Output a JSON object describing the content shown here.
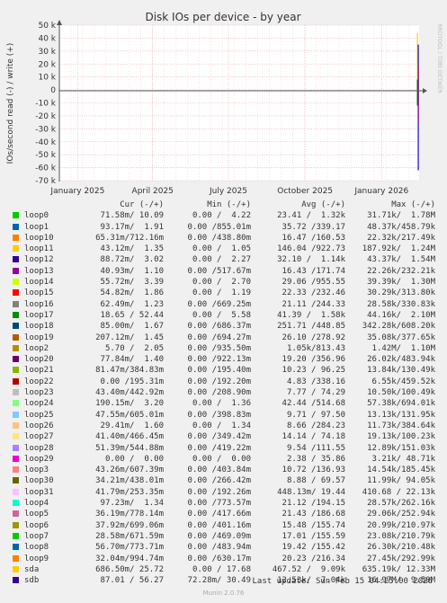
{
  "chart_data": {
    "type": "line",
    "title": "Disk IOs per device - by year",
    "ylabel": "IOs/second read (-) / write (+)",
    "side_label": "RRDTOOL / TOBI OETIKER",
    "ylim": [
      -70000,
      50000
    ],
    "y_ticks": [
      50000,
      40000,
      30000,
      20000,
      10000,
      0,
      -10000,
      -20000,
      -30000,
      -40000,
      -50000,
      -60000,
      -70000
    ],
    "y_tick_labels": [
      "50 k",
      "40 k",
      "30 k",
      "20 k",
      "10 k",
      "0",
      "-10 k",
      "-20 k",
      "-30 k",
      "-40 k",
      "-50 k",
      "-60 k",
      "-70 k"
    ],
    "x_range": [
      "2024-12-10",
      "2026-02-15"
    ],
    "x_ticks": [
      "2025-01-01",
      "2025-04-01",
      "2025-07-01",
      "2025-10-01",
      "2026-01-01"
    ],
    "x_tick_labels": [
      "January 2025",
      "April 2025",
      "July 2025",
      "October 2025",
      "January 2026"
    ],
    "grid": true,
    "series_spikes": [
      {
        "color": "#ffcc00",
        "x": "2026-02-13",
        "y_top": 44000,
        "y_bottom": -9500
      },
      {
        "color": "#1a00cc",
        "x": "2026-02-14",
        "y_top": 35000,
        "y_bottom": -62000
      },
      {
        "color": "#880088",
        "x": "2026-02-14",
        "y_top": 18000,
        "y_bottom": -25000
      },
      {
        "color": "#006600",
        "x": "2026-02-13",
        "y_top": 8000,
        "y_bottom": -12000
      }
    ],
    "headers": {
      "cur": "Cur (-/+)",
      "min": "Min (-/+)",
      "avg": "Avg (-/+)",
      "max": "Max (-/+)"
    },
    "series": [
      {
        "name": "loop0",
        "color": "#00cc00",
        "cur": "71.58m/ 10.09",
        "min": "0.00 /  4.22",
        "avg": "23.41 /  1.32k",
        "max": "31.71k/  1.78M"
      },
      {
        "name": "loop1",
        "color": "#0066b3",
        "cur": "93.17m/  1.91",
        "min": "0.00 /855.01m",
        "avg": "35.72 /339.17",
        "max": "48.37k/458.79k"
      },
      {
        "name": "loop10",
        "color": "#ff8000",
        "cur": "65.31m/712.16m",
        "min": "0.00 /438.80m",
        "avg": "16.47 /160.53",
        "max": "22.32k/217.49k"
      },
      {
        "name": "loop11",
        "color": "#ffcc00",
        "cur": "43.12m/  1.35",
        "min": "0.00 /  1.05",
        "avg": "146.04 /922.73",
        "max": "187.92k/  1.24M"
      },
      {
        "name": "loop12",
        "color": "#330099",
        "cur": "88.72m/  3.02",
        "min": "0.00 /  2.27",
        "avg": "32.10 /  1.14k",
        "max": "43.37k/  1.54M"
      },
      {
        "name": "loop13",
        "color": "#990099",
        "cur": "40.93m/  1.10",
        "min": "0.00 /517.67m",
        "avg": "16.43 /171.74",
        "max": "22.26k/232.21k"
      },
      {
        "name": "loop14",
        "color": "#ccff00",
        "cur": "55.72m/  3.39",
        "min": "0.00 /  2.70",
        "avg": "29.06 /955.55",
        "max": "39.39k/  1.30M"
      },
      {
        "name": "loop15",
        "color": "#ff0000",
        "cur": "54.82m/  1.86",
        "min": "0.00 /  1.19",
        "avg": "22.33 /232.46",
        "max": "30.29k/313.80k"
      },
      {
        "name": "loop16",
        "color": "#808080",
        "cur": "62.49m/  1.23",
        "min": "0.00 /669.25m",
        "avg": "21.11 /244.33",
        "max": "28.58k/330.83k"
      },
      {
        "name": "loop17",
        "color": "#008f00",
        "cur": "18.65 / 52.44",
        "min": "0.00 /  5.58",
        "avg": "41.39 /  1.58k",
        "max": "44.16k/  2.10M"
      },
      {
        "name": "loop18",
        "color": "#00487d",
        "cur": "85.00m/  1.67",
        "min": "0.00 /686.37m",
        "avg": "251.71 /448.85",
        "max": "342.28k/608.20k"
      },
      {
        "name": "loop19",
        "color": "#b35a00",
        "cur": "207.12m/  1.45",
        "min": "0.00 /694.27m",
        "avg": "26.10 /278.92",
        "max": "35.08k/377.65k"
      },
      {
        "name": "loop2",
        "color": "#b38f00",
        "cur": "5.70 /  2.05",
        "min": "0.00 /935.50m",
        "avg": "1.05k/813.43",
        "max": "1.42M/  1.10M"
      },
      {
        "name": "loop20",
        "color": "#6b006b",
        "cur": "77.84m/  1.40",
        "min": "0.00 /922.13m",
        "avg": "19.20 /356.96",
        "max": "26.02k/483.94k"
      },
      {
        "name": "loop21",
        "color": "#8fb300",
        "cur": "81.47m/384.83m",
        "min": "0.00 /195.40m",
        "avg": "10.23 / 96.25",
        "max": "13.84k/130.49k"
      },
      {
        "name": "loop22",
        "color": "#b30000",
        "cur": "0.00 /195.31m",
        "min": "0.00 /192.20m",
        "avg": "4.83 /338.16",
        "max": "6.55k/459.52k"
      },
      {
        "name": "loop23",
        "color": "#bebebe",
        "cur": "43.40m/442.92m",
        "min": "0.00 /208.90m",
        "avg": "7.77 / 74.29",
        "max": "10.50k/100.49k"
      },
      {
        "name": "loop24",
        "color": "#80ff80",
        "cur": "190.15m/  3.20",
        "min": "0.00 /  1.36",
        "avg": "42.44 /514.68",
        "max": "57.38k/694.01k"
      },
      {
        "name": "loop25",
        "color": "#80c9ff",
        "cur": "47.55m/605.01m",
        "min": "0.00 /398.83m",
        "avg": "9.71 / 97.50",
        "max": "13.13k/131.95k"
      },
      {
        "name": "loop26",
        "color": "#ffc080",
        "cur": "29.41m/  1.60",
        "min": "0.00 /  1.34",
        "avg": "8.66 /284.23",
        "max": "11.73k/384.64k"
      },
      {
        "name": "loop27",
        "color": "#ffe680",
        "cur": "41.40m/466.45m",
        "min": "0.00 /349.42m",
        "avg": "14.14 / 74.18",
        "max": "19.13k/100.23k"
      },
      {
        "name": "loop28",
        "color": "#aa80ff",
        "cur": "51.39m/544.88m",
        "min": "0.00 /419.22m",
        "avg": "9.54 /111.55",
        "max": "12.89k/151.03k"
      },
      {
        "name": "loop29",
        "color": "#ee00cc",
        "cur": "0.00 /  0.00",
        "min": "0.00 /  0.00",
        "avg": "2.38 / 35.86",
        "max": "3.21k/ 48.71k"
      },
      {
        "name": "loop3",
        "color": "#ff8080",
        "cur": "43.26m/607.39m",
        "min": "0.00 /403.84m",
        "avg": "10.72 /136.93",
        "max": "14.54k/185.45k"
      },
      {
        "name": "loop30",
        "color": "#666600",
        "cur": "34.21m/438.01m",
        "min": "0.00 /266.42m",
        "avg": "8.88 / 69.57",
        "max": "11.99k/ 94.05k"
      },
      {
        "name": "loop31",
        "color": "#ffbfff",
        "cur": "41.79m/253.35m",
        "min": "0.00 /192.26m",
        "avg": "448.13m/ 19.44",
        "max": "410.68 / 22.13k"
      },
      {
        "name": "loop4",
        "color": "#00ffcc",
        "cur": "97.23m/  1.34",
        "min": "0.00 /773.57m",
        "avg": "21.12 /194.15",
        "max": "28.57k/262.16k"
      },
      {
        "name": "loop5",
        "color": "#cc6699",
        "cur": "36.19m/778.14m",
        "min": "0.00 /417.66m",
        "avg": "21.43 /186.68",
        "max": "29.06k/252.94k"
      },
      {
        "name": "loop6",
        "color": "#999900",
        "cur": "37.92m/699.06m",
        "min": "0.00 /401.16m",
        "avg": "15.48 /155.74",
        "max": "20.99k/210.97k"
      },
      {
        "name": "loop7",
        "color": "#00cc00",
        "cur": "28.58m/671.59m",
        "min": "0.00 /469.09m",
        "avg": "17.01 /155.59",
        "max": "23.08k/210.79k"
      },
      {
        "name": "loop8",
        "color": "#0066b3",
        "cur": "56.70m/773.71m",
        "min": "0.00 /483.94m",
        "avg": "19.42 /155.42",
        "max": "26.30k/210.48k"
      },
      {
        "name": "loop9",
        "color": "#ff8000",
        "cur": "32.04m/994.74m",
        "min": "0.00 /630.17m",
        "avg": "20.23 /216.34",
        "max": "27.45k/292.99k"
      },
      {
        "name": "sda",
        "color": "#ffcc00",
        "cur": "686.50m/ 25.72",
        "min": "0.00 / 17.68",
        "avg": "467.52 /  9.09k",
        "max": "635.19k/ 12.33M"
      },
      {
        "name": "sdb",
        "color": "#330099",
        "cur": "87.01 / 56.27",
        "min": "72.28m/ 30.49",
        "avg": "12.53k/  7.04k",
        "max": "16.97M/  9.50M"
      }
    ],
    "last_update": "Last update:  Sun Feb 15 04:25:00 2026",
    "footer": "Munin 2.0.76"
  }
}
